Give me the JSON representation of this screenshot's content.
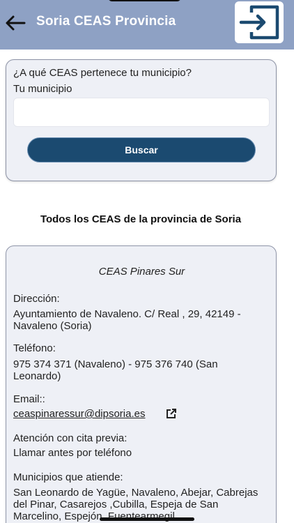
{
  "header": {
    "title": "Soria CEAS Provincia",
    "back_icon": "arrow-left-icon",
    "exit_icon": "exit-icon",
    "accent": "#8ea1c4"
  },
  "search": {
    "question": "¿A qué CEAS pertenece tu municipio?",
    "municipio_label": "Tu municipio",
    "municipio_value": "",
    "button_label": "Buscar",
    "button_color": "#1b4a70"
  },
  "list": {
    "section_title": "Todos los CEAS de la provincia de Soria"
  },
  "ceas": {
    "name": "CEAS Pinares Sur",
    "direccion_label": "Dirección:",
    "direccion": "Ayuntamiento de Navaleno. C/ Real , 29, 42149 - Navaleno (Soria)",
    "telefono_label": "Teléfono:",
    "telefono": "975 374 371 (Navaleno) - 975 376 740 (San Leonardo)",
    "email_label": "Email::",
    "email": "ceaspinaressur@dipsoria.es",
    "atencion_label": "Atención con cita previa:",
    "atencion": "Llamar antes por teléfono",
    "municipios_label": "Municipios que atiende:",
    "municipios": "San Leonardo de Yagüe, Navaleno, Abejar, Cabrejas del Pinar, Casarejos ,Cubilla, Espeja de San Marcelino, Espejón, Fuentearmegil,"
  }
}
